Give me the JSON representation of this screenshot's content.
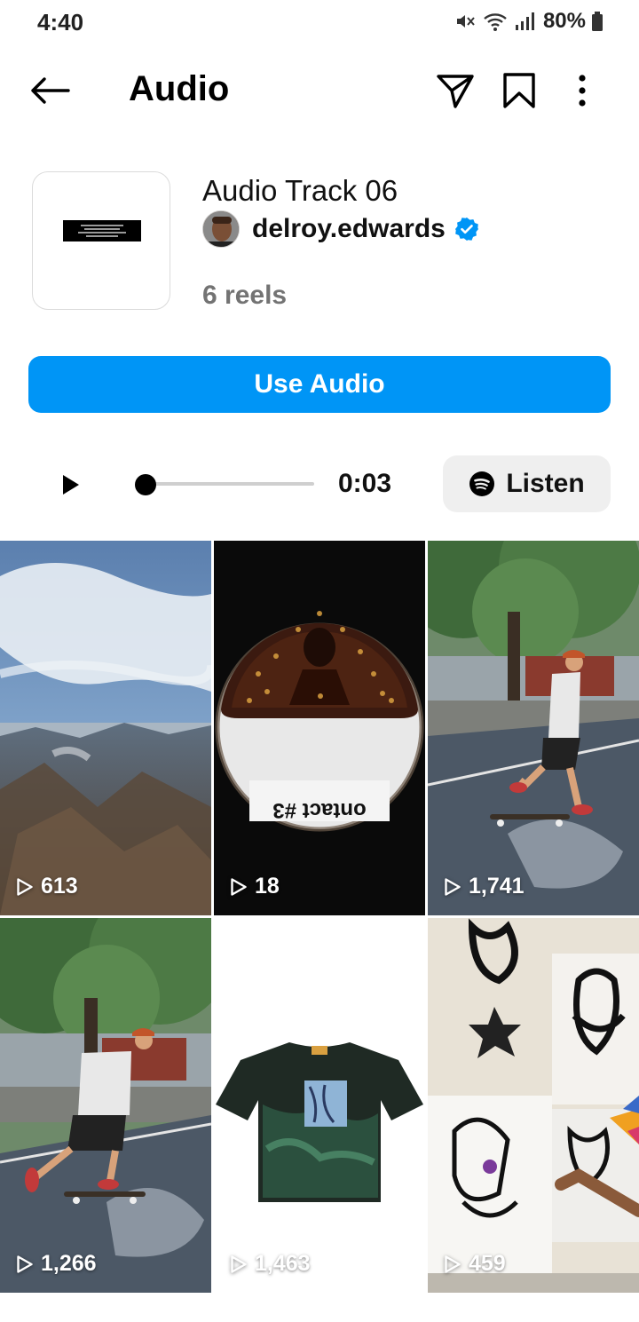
{
  "status_bar": {
    "time": "4:40",
    "battery": "80%"
  },
  "header": {
    "title": "Audio"
  },
  "track": {
    "title": "Audio Track 06",
    "artist": "delroy.edwards",
    "reels_count": "6 reels"
  },
  "actions": {
    "use_audio_label": "Use Audio",
    "listen_label": "Listen"
  },
  "player": {
    "time": "0:03",
    "progress": 0.05
  },
  "reels": [
    {
      "views": "613",
      "scene": "aerial mountains under sky"
    },
    {
      "views": "18",
      "scene": "dark fisheye album art"
    },
    {
      "views": "1,741",
      "scene": "skateboarder in park"
    },
    {
      "views": "1,266",
      "scene": "skateboarder in park"
    },
    {
      "views": "1,463",
      "scene": "painted t-shirt"
    },
    {
      "views": "459",
      "scene": "graffiti painting on wall"
    }
  ],
  "colors": {
    "accent": "#0095f6",
    "verified": "#0095f6",
    "secondary_text": "#737373",
    "listen_bg": "#efefef"
  },
  "icons": {
    "back": "arrow-left-icon",
    "send": "send-icon",
    "save": "bookmark-icon",
    "more": "more-vertical-icon",
    "play": "play-icon",
    "spotify": "spotify-icon",
    "views": "play-outline-icon",
    "verified": "verified-badge-icon"
  }
}
